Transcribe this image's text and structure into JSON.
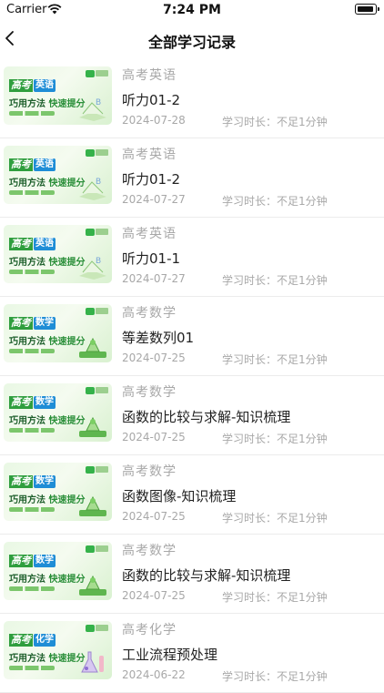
{
  "status_bar": {
    "carrier": "Carrier",
    "time": "7:24 PM"
  },
  "header": {
    "title": "全部学习记录"
  },
  "thumbnail": {
    "gaokao": "高考",
    "slogan_a": "巧用方法",
    "slogan_b": "快速提分"
  },
  "records": [
    {
      "subject": "高考英语",
      "thumb_subject": "英语",
      "lesson": "听力01-2",
      "date": "2024-07-28",
      "duration": "学习时长：不足1分钟",
      "thumb_icon": "book-icon"
    },
    {
      "subject": "高考英语",
      "thumb_subject": "英语",
      "lesson": "听力01-2",
      "date": "2024-07-27",
      "duration": "学习时长：不足1分钟",
      "thumb_icon": "book-icon"
    },
    {
      "subject": "高考英语",
      "thumb_subject": "英语",
      "lesson": "听力01-1",
      "date": "2024-07-27",
      "duration": "学习时长：不足1分钟",
      "thumb_icon": "book-icon"
    },
    {
      "subject": "高考数学",
      "thumb_subject": "数学",
      "lesson": "等差数列01",
      "date": "2024-07-25",
      "duration": "学习时长：不足1分钟",
      "thumb_icon": "geometry-icon"
    },
    {
      "subject": "高考数学",
      "thumb_subject": "数学",
      "lesson": "函数的比较与求解-知识梳理",
      "date": "2024-07-25",
      "duration": "学习时长：不足1分钟",
      "thumb_icon": "geometry-icon"
    },
    {
      "subject": "高考数学",
      "thumb_subject": "数学",
      "lesson": "函数图像-知识梳理",
      "date": "2024-07-25",
      "duration": "学习时长：不足1分钟",
      "thumb_icon": "geometry-icon"
    },
    {
      "subject": "高考数学",
      "thumb_subject": "数学",
      "lesson": "函数的比较与求解-知识梳理",
      "date": "2024-07-25",
      "duration": "学习时长：不足1分钟",
      "thumb_icon": "geometry-icon"
    },
    {
      "subject": "高考化学",
      "thumb_subject": "化学",
      "lesson": "工业流程预处理",
      "date": "2024-06-22",
      "duration": "学习时长：不足1分钟",
      "thumb_icon": "flask-icon"
    }
  ],
  "colors": {
    "accent_green": "#2f9e3e",
    "subject_blue": "#1f8dd6",
    "muted_text": "#a8a8a8"
  }
}
